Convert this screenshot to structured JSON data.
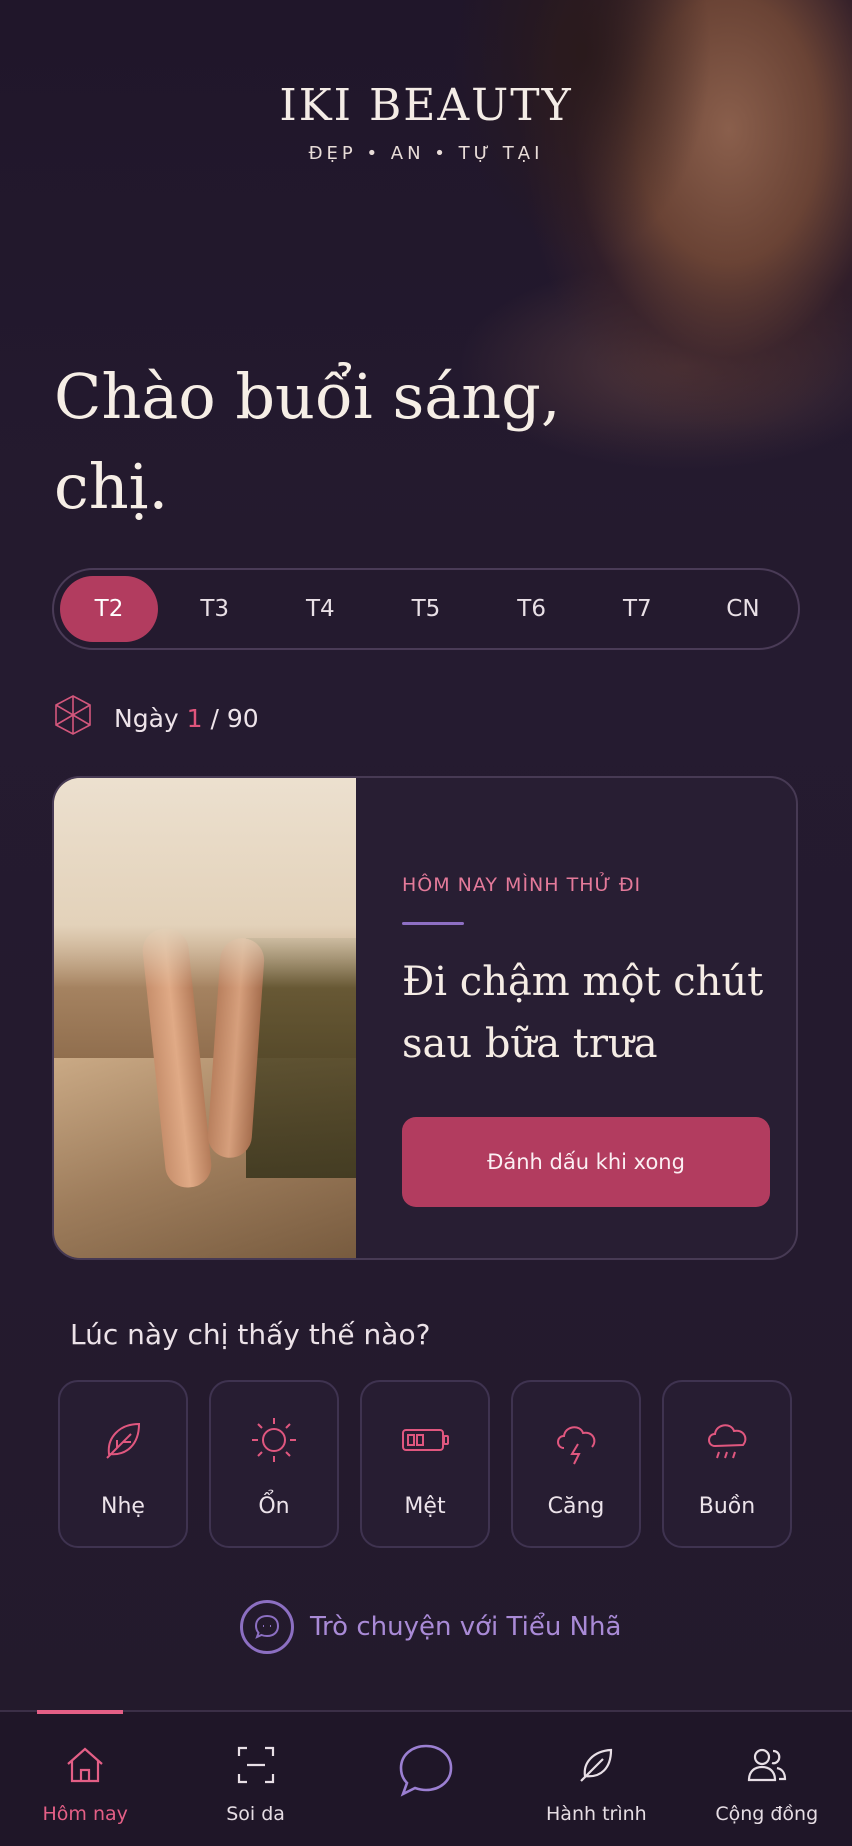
{
  "brand": {
    "name": "IKI BEAUTY",
    "tagline": "ĐẸP • AN • TỰ TẠI"
  },
  "greeting": "Chào buổi sáng, chị.",
  "days": [
    {
      "label": "T2",
      "active": true
    },
    {
      "label": "T3",
      "active": false
    },
    {
      "label": "T4",
      "active": false
    },
    {
      "label": "T5",
      "active": false
    },
    {
      "label": "T6",
      "active": false
    },
    {
      "label": "T7",
      "active": false
    },
    {
      "label": "CN",
      "active": false
    }
  ],
  "progress": {
    "prefix": "Ngày",
    "current": "1",
    "total": "/ 90",
    "icon": "cube-icon"
  },
  "task_card": {
    "eyebrow": "HÔM NAY MÌNH THỬ ĐI",
    "title": "Đi chậm một chút sau bữa trưa",
    "button": "Đánh dấu khi xong",
    "image": "walking-feet-photo"
  },
  "mood": {
    "question": "Lúc này chị thấy thế nào?",
    "options": [
      {
        "label": "Nhẹ",
        "icon": "leaf-icon"
      },
      {
        "label": "Ổn",
        "icon": "sun-icon"
      },
      {
        "label": "Mệt",
        "icon": "low-battery-icon"
      },
      {
        "label": "Căng",
        "icon": "storm-cloud-icon"
      },
      {
        "label": "Buồn",
        "icon": "rain-cloud-icon"
      }
    ]
  },
  "chat_link": {
    "label": "Trò chuyện với Tiểu Nhã",
    "icon": "chat-bubble-icon"
  },
  "tabbar": [
    {
      "label": "Hôm nay",
      "icon": "home-icon",
      "active": true
    },
    {
      "label": "Soi da",
      "icon": "face-scan-icon",
      "active": false
    },
    {
      "label": "",
      "icon": "chat-bubble-icon",
      "active": false
    },
    {
      "label": "Hành trình",
      "icon": "leaf-icon",
      "active": false
    },
    {
      "label": "Cộng đồng",
      "icon": "community-icon",
      "active": false
    }
  ],
  "colors": {
    "background": "#241a2e",
    "accent": "#b23c5f",
    "accent_text": "#e47a9a",
    "lavender": "#a98ad6"
  }
}
